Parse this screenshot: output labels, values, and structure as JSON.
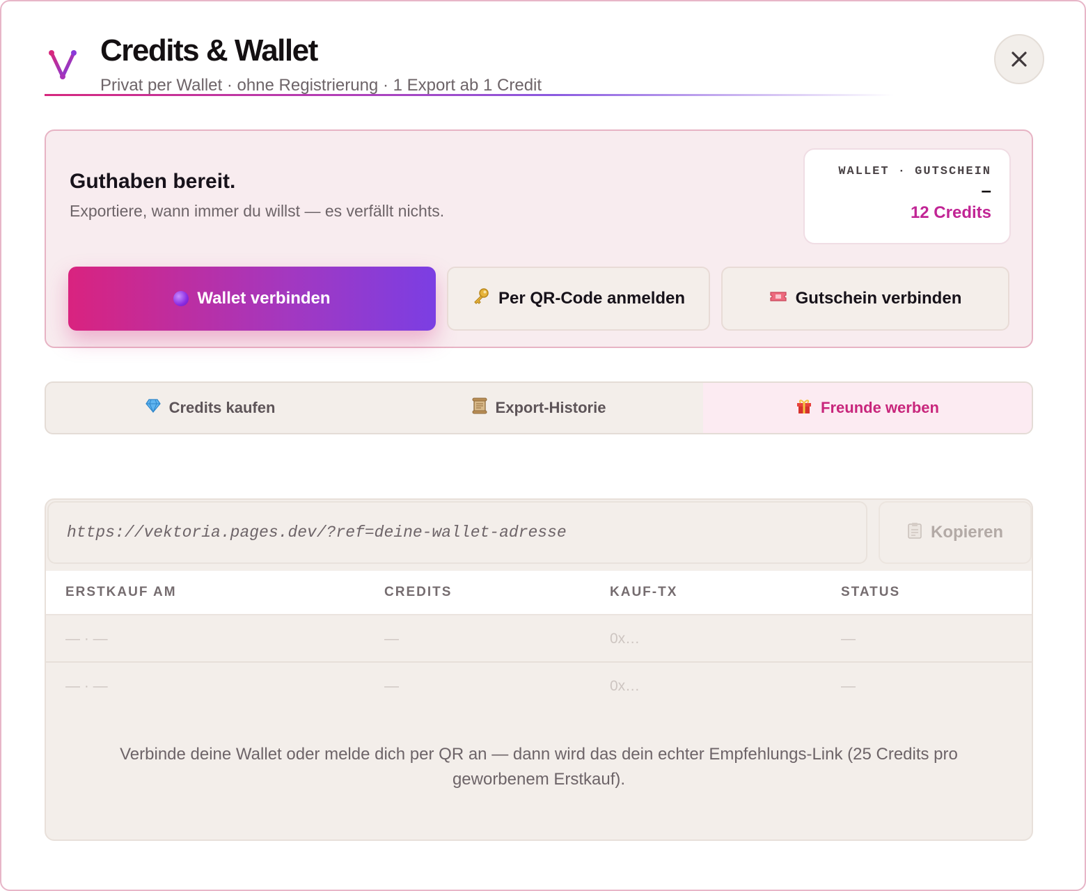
{
  "header": {
    "logo_letter": "V",
    "title": "Credits & Wallet",
    "subtitle": "Privat per Wallet · ohne Registrierung · 1 Export ab 1 Credit",
    "close_icon": "close-icon"
  },
  "status": {
    "title": "Guthaben bereit.",
    "subtitle": "Exportiere, wann immer du willst — es verfällt nichts.",
    "balance_label": "WALLET · GUTSCHEIN",
    "balance_dash": "–",
    "balance_value": "12 Credits"
  },
  "actions": {
    "wallet_label": "Wallet verbinden",
    "qr_label": "Per QR-Code anmelden",
    "voucher_label": "Gutschein verbinden"
  },
  "tabs": [
    {
      "label": "Credits kaufen",
      "icon": "gem-icon",
      "active": false
    },
    {
      "label": "Export-Historie",
      "icon": "scroll-icon",
      "active": false
    },
    {
      "label": "Freunde werben",
      "icon": "gift-icon",
      "active": true
    }
  ],
  "referral": {
    "link_value": "https://vektoria.pages.dev/?ref=deine-wallet-adresse",
    "copy_label": "Kopieren",
    "columns": [
      "ERSTKAUF AM",
      "CREDITS",
      "KAUF-TX",
      "STATUS"
    ],
    "rows": [
      [
        "— · —",
        "—",
        "0x…",
        "—"
      ],
      [
        "— · —",
        "—",
        "0x…",
        "—"
      ]
    ],
    "note": "Verbinde deine Wallet oder melde dich per QR an — dann wird das dein echter Empfehlungs-Link (25 Credits pro geworbenem Erstkauf)."
  },
  "colors": {
    "accent_pink": "#d9237f",
    "accent_purple": "#7b3ee3",
    "credits_value": "#c12595"
  }
}
